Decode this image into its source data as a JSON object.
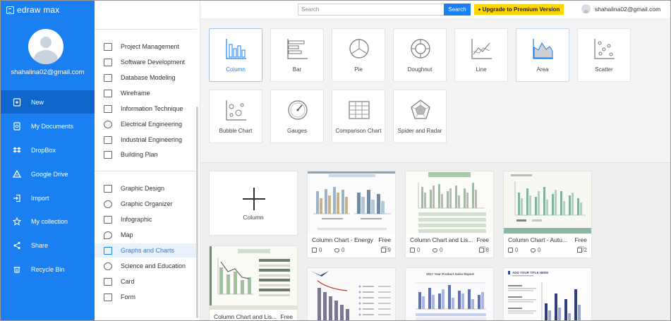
{
  "app": {
    "name": "edraw max"
  },
  "user": {
    "email": "shahalina02@gmail.com"
  },
  "sidebar": {
    "items": [
      {
        "label": "New",
        "icon": "new-file-icon"
      },
      {
        "label": "My Documents",
        "icon": "documents-icon"
      },
      {
        "label": "DropBox",
        "icon": "dropbox-icon"
      },
      {
        "label": "Google Drive",
        "icon": "google-drive-icon"
      },
      {
        "label": "Import",
        "icon": "import-icon"
      },
      {
        "label": "My collection",
        "icon": "star-icon"
      },
      {
        "label": "Share",
        "icon": "share-icon"
      },
      {
        "label": "Recycle Bin",
        "icon": "recycle-bin-icon"
      }
    ],
    "active": "New"
  },
  "categories": {
    "group1": [
      "Project Management",
      "Software Development",
      "Database Modeling",
      "Wireframe",
      "Electrical Engineering",
      "Information Technique",
      "Industrial Engineering",
      "Building Plan"
    ],
    "group2": [
      "Graphic Design",
      "Graphic Organizer",
      "Infographic",
      "Map",
      "Graphs and Charts",
      "Science and Education",
      "Card",
      "Form"
    ],
    "active": "Graphs and Charts"
  },
  "topbar": {
    "search_placeholder": "Search",
    "search_button": "Search",
    "upgrade_label": "Upgrade to Premium Version",
    "user_email": "shahalina02@gmail.com"
  },
  "chart_types": [
    {
      "label": "Column",
      "selected": true
    },
    {
      "label": "Bar"
    },
    {
      "label": "Pie"
    },
    {
      "label": "Doughnut"
    },
    {
      "label": "Line"
    },
    {
      "label": "Area"
    },
    {
      "label": "Scatter"
    },
    {
      "label": "Bubble Chart"
    },
    {
      "label": "Gauges"
    },
    {
      "label": "Comparison Chart"
    },
    {
      "label": "Spider and Radar"
    }
  ],
  "templates": {
    "new_label": "Column",
    "cards": [
      {
        "title": "Column Chart - Energy",
        "badge": "Free",
        "likes": "0",
        "hearts": "0",
        "copies": "9"
      },
      {
        "title": "Column Chart and Lis...",
        "badge": "Free",
        "likes": "0",
        "hearts": "0",
        "copies": "8"
      },
      {
        "title": "Column Chart - Autu...",
        "badge": "Free",
        "likes": "0",
        "hearts": "0",
        "copies": "2"
      },
      {
        "title": "Column Chart and Lis...",
        "badge": "Free"
      },
      {
        "title": "",
        "badge": ""
      },
      {
        "title": "",
        "badge": "",
        "thumb_caption": "2017 Year Product Sales Report"
      },
      {
        "title": "",
        "badge": "",
        "thumb_caption": "ADD YOUR TITLE HERE"
      }
    ]
  },
  "colors": {
    "brand_blue": "#1a7ff0",
    "active_nav": "#0e66cc",
    "upgrade_yellow": "#ffd600"
  }
}
